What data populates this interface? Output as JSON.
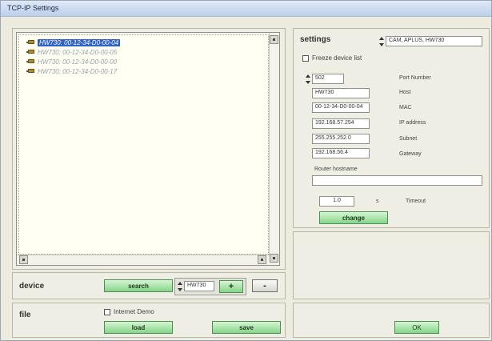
{
  "window": {
    "title": "TCP-IP Settings"
  },
  "devices": {
    "items": [
      {
        "label": "HW730: 00-12-34-D0-00-04",
        "selected": true
      },
      {
        "label": "HW730: 00-12-34-D0-00-05",
        "selected": false
      },
      {
        "label": "HW730: 00-12-34-D0-00-00",
        "selected": false
      },
      {
        "label": "HW730: 00-12-34-D0-00-17",
        "selected": false
      }
    ]
  },
  "device": {
    "label": "device",
    "search_label": "search",
    "model_value": "HW730",
    "add_label": "+",
    "remove_label": "-"
  },
  "file": {
    "label": "file",
    "internet_demo_label": "Internet Demo",
    "load_label": "load",
    "save_label": "save"
  },
  "settings": {
    "title": "settings",
    "device_type_value": "CAM, APLUS, HW730",
    "freeze_label": "Freeze device list",
    "port": {
      "value": "502",
      "label": "Port Number"
    },
    "host": {
      "value": "HW730",
      "label": "Host"
    },
    "mac": {
      "value": "00-12-34-D0-00-04",
      "label": "MAC"
    },
    "ip": {
      "value": "192.168.57.254",
      "label": "IP address"
    },
    "subnet": {
      "value": "255.255.252.0",
      "label": "Subnet"
    },
    "gateway": {
      "value": "192.168.56.4",
      "label": "Gateway"
    },
    "router_hostname_label": "Router hostname",
    "router_hostname_value": "",
    "timeout": {
      "value": "1.0",
      "unit": "s",
      "label": "Timeout"
    },
    "change_label": "change"
  },
  "ok_label": "OK"
}
